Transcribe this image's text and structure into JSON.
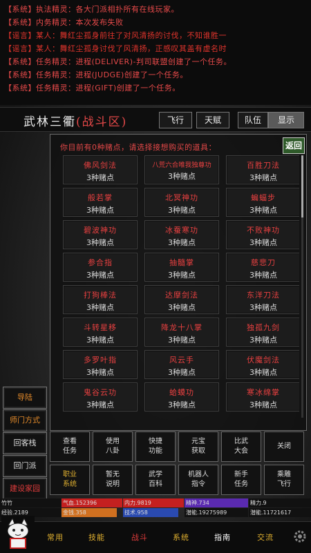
{
  "log": [
    {
      "tag": "【系统】",
      "text": "执法精灵：各大门派相扑所有在线玩家。",
      "type": "system"
    },
    {
      "tag": "【系统】",
      "text": "内务精灵：本次发布失败",
      "type": "system"
    },
    {
      "tag": "【谣言】",
      "text": "某人：舞红尘孤身前往了对风清扬的讨伐，不知谁胜一",
      "type": "rumor"
    },
    {
      "tag": "【谣言】",
      "text": "某人：舞红尘孤身讨伐了风清扬，正感叹其盖有虚名时",
      "type": "rumor"
    },
    {
      "tag": "【系统】",
      "text": "任务精灵：进程(DELIVER)-判司联盟创建了一个任务。",
      "type": "system"
    },
    {
      "tag": "【系统】",
      "text": "任务精灵：进程(JUDGE)创建了一个任务。",
      "type": "system"
    },
    {
      "tag": "【系统】",
      "text": "任务精灵：进程(GIFT)创建了一个任务。",
      "type": "system"
    }
  ],
  "title": {
    "main": "武林三衢",
    "sub": "(战斗区)"
  },
  "top_buttons": [
    "飞行",
    "天赋",
    "队伍",
    "显示"
  ],
  "sidebar": [
    "导陆",
    "师门方式",
    "回客栈",
    "回门派",
    "建设家园"
  ],
  "panel": {
    "notice": "你目前有0种赌点，请选择接想购买的道具：",
    "return_label": "返回",
    "items": [
      {
        "name": "佛风剑法",
        "cost": "3种赌点"
      },
      {
        "name": "八荒六合唯我独尊功",
        "cost": "3种赌点"
      },
      {
        "name": "百胜刀法",
        "cost": "3种赌点"
      },
      {
        "name": "般若掌",
        "cost": "3种赌点"
      },
      {
        "name": "北冥神功",
        "cost": "3种赌点"
      },
      {
        "name": "蝙蝠步",
        "cost": "3种赌点"
      },
      {
        "name": "碧波神功",
        "cost": "3种赌点"
      },
      {
        "name": "冰蚕寒功",
        "cost": "3种赌点"
      },
      {
        "name": "不败神功",
        "cost": "3种赌点"
      },
      {
        "name": "参合指",
        "cost": "3种赌点"
      },
      {
        "name": "抽髓掌",
        "cost": "3种赌点"
      },
      {
        "name": "慈悲刀",
        "cost": "3种赌点"
      },
      {
        "name": "打狗棒法",
        "cost": "3种赌点"
      },
      {
        "name": "达摩剑法",
        "cost": "3种赌点"
      },
      {
        "name": "东洋刀法",
        "cost": "3种赌点"
      },
      {
        "name": "斗转星移",
        "cost": "3种赌点"
      },
      {
        "name": "降龙十八掌",
        "cost": "3种赌点"
      },
      {
        "name": "独孤九剑",
        "cost": "3种赌点"
      },
      {
        "name": "多罗叶指",
        "cost": "3种赌点"
      },
      {
        "name": "风云手",
        "cost": "3种赌点"
      },
      {
        "name": "伏魔剑法",
        "cost": "3种赌点"
      },
      {
        "name": "鬼谷云功",
        "cost": "3种赌点"
      },
      {
        "name": "蛤蟆功",
        "cost": "3种赌点"
      },
      {
        "name": "寒冰绵掌",
        "cost": "3种赌点"
      }
    ]
  },
  "functions_row1": [
    {
      "l1": "查看",
      "l2": "任务"
    },
    {
      "l1": "使用",
      "l2": "八卦"
    },
    {
      "l1": "快捷",
      "l2": "功能"
    },
    {
      "l1": "元宝",
      "l2": "获取"
    },
    {
      "l1": "比武",
      "l2": "大会"
    },
    {
      "l1": "关闭",
      "l2": ""
    }
  ],
  "functions_row2": [
    {
      "l1": "职业",
      "l2": "系统",
      "yellow": true
    },
    {
      "l1": "暂无",
      "l2": "说明"
    },
    {
      "l1": "武学",
      "l2": "百科"
    },
    {
      "l1": "机器人",
      "l2": "指令"
    },
    {
      "l1": "新手",
      "l2": "任务"
    },
    {
      "l1": "乘雕",
      "l2": "飞行"
    }
  ],
  "status": {
    "name": "竹竹",
    "qi": "气血.152396",
    "neili": "内力.9819",
    "jingshen": "精神.734",
    "jingli": "精力.9",
    "jingyan": "经验.2189",
    "gold": "金钱.358",
    "points": "技术.958",
    "potential": "潜能.19275989",
    "reputation": "潜能.11721617",
    "colors": {
      "qi": "#c42020",
      "neili": "#c42020",
      "jingshen": "#5a2ab0",
      "gold": "#d07020",
      "points": "#2a4ab0"
    }
  },
  "nav": [
    {
      "label": "常用",
      "color": "#e0b030"
    },
    {
      "label": "技能",
      "color": "#e0b030"
    },
    {
      "label": "战斗",
      "color": "#e23c3c"
    },
    {
      "label": "系统",
      "color": "#e0b030"
    },
    {
      "label": "指南",
      "color": "#ffffff"
    },
    {
      "label": "交流",
      "color": "#e0b030"
    }
  ],
  "icons": {
    "avatar": "cat-avatar-icon",
    "settings": "gear-icon"
  }
}
